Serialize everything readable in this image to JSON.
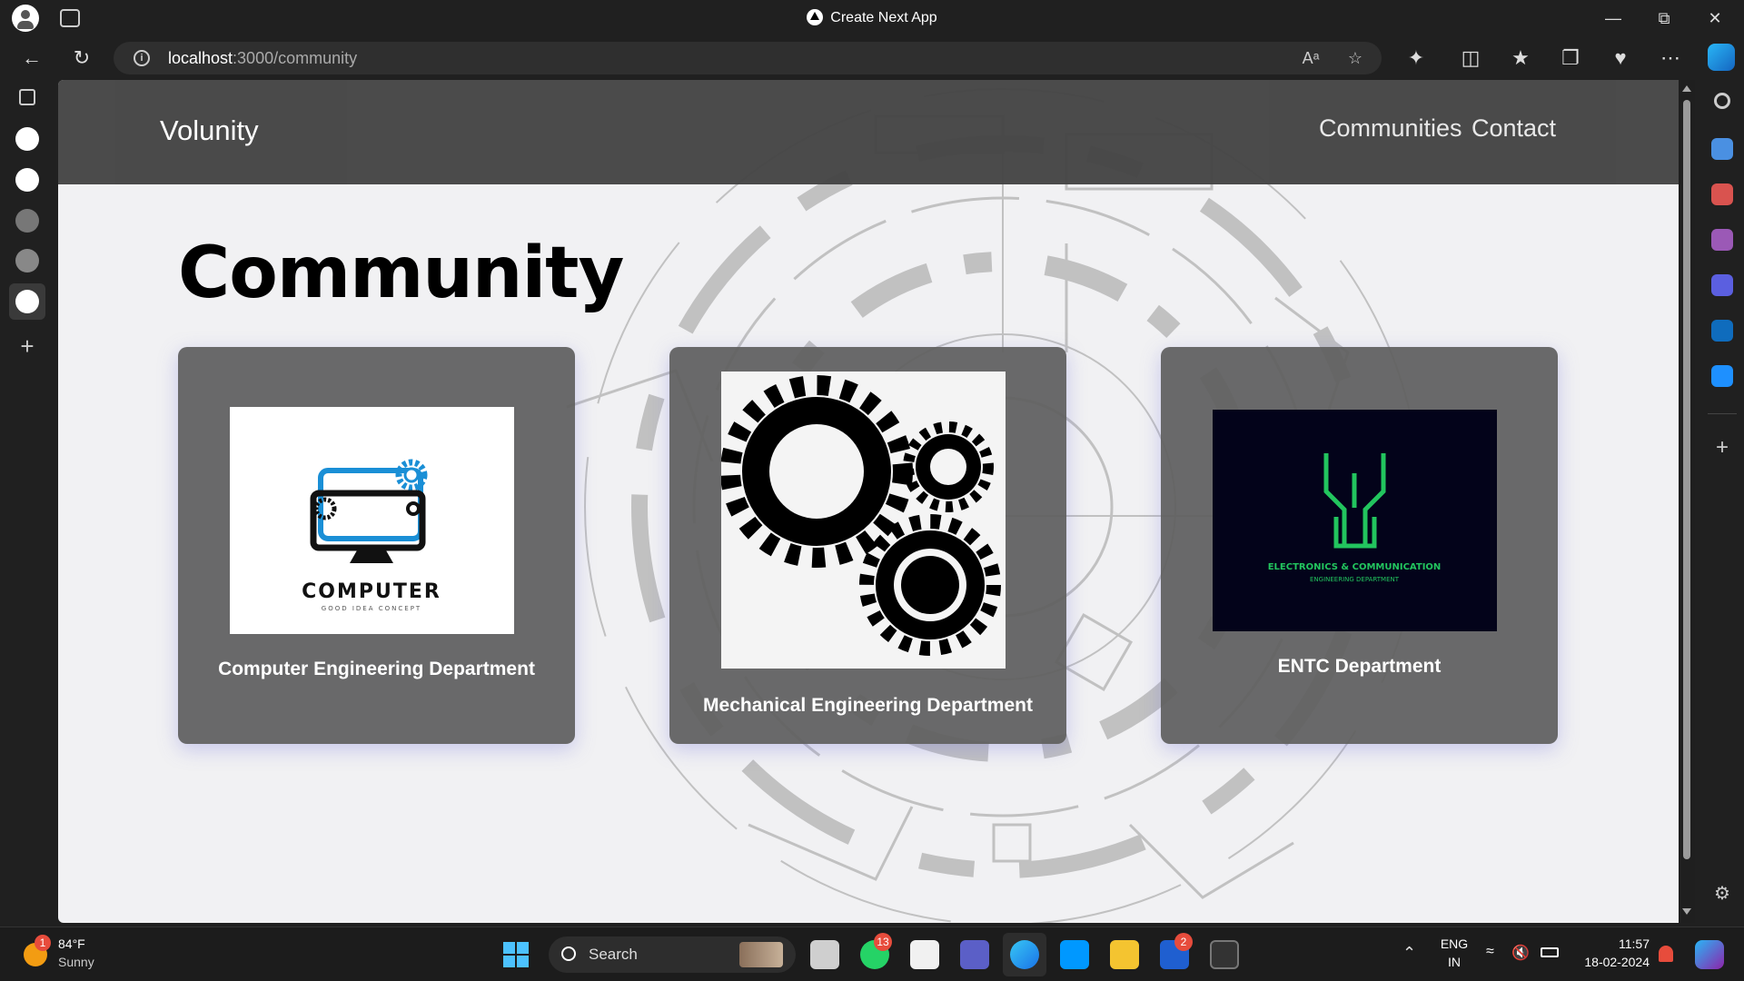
{
  "browser": {
    "window_title": "Create Next App",
    "url_host": "localhost",
    "url_path": ":3000/community"
  },
  "site": {
    "brand": "Volunity",
    "nav": [
      {
        "label": "Communities"
      },
      {
        "label": "Contact"
      }
    ],
    "page_title": "Community",
    "cards": [
      {
        "label": "Computer Engineering Department",
        "image": {
          "title": "COMPUTER",
          "subtitle": "GOOD IDEA CONCEPT"
        }
      },
      {
        "label": "Mechanical Engineering Department",
        "image": {
          "title": ""
        }
      },
      {
        "label": "ENTC Department",
        "image": {
          "title": "ELECTRONICS & COMMUNICATION",
          "subtitle": "ENGINEERING DEPARTMENT"
        }
      }
    ]
  },
  "taskbar": {
    "weather_temp": "84°F",
    "weather_desc": "Sunny",
    "weather_badge": "1",
    "search_label": "Search",
    "whatsapp_badge": "13",
    "lapp_badge": "2",
    "lang_1": "ENG",
    "lang_2": "IN",
    "time": "11:57",
    "date": "18-02-2024"
  },
  "colors": {
    "accent_blue": "#1a8fd6",
    "entc_green": "#22c55e",
    "entc_bg": "#03031a"
  }
}
